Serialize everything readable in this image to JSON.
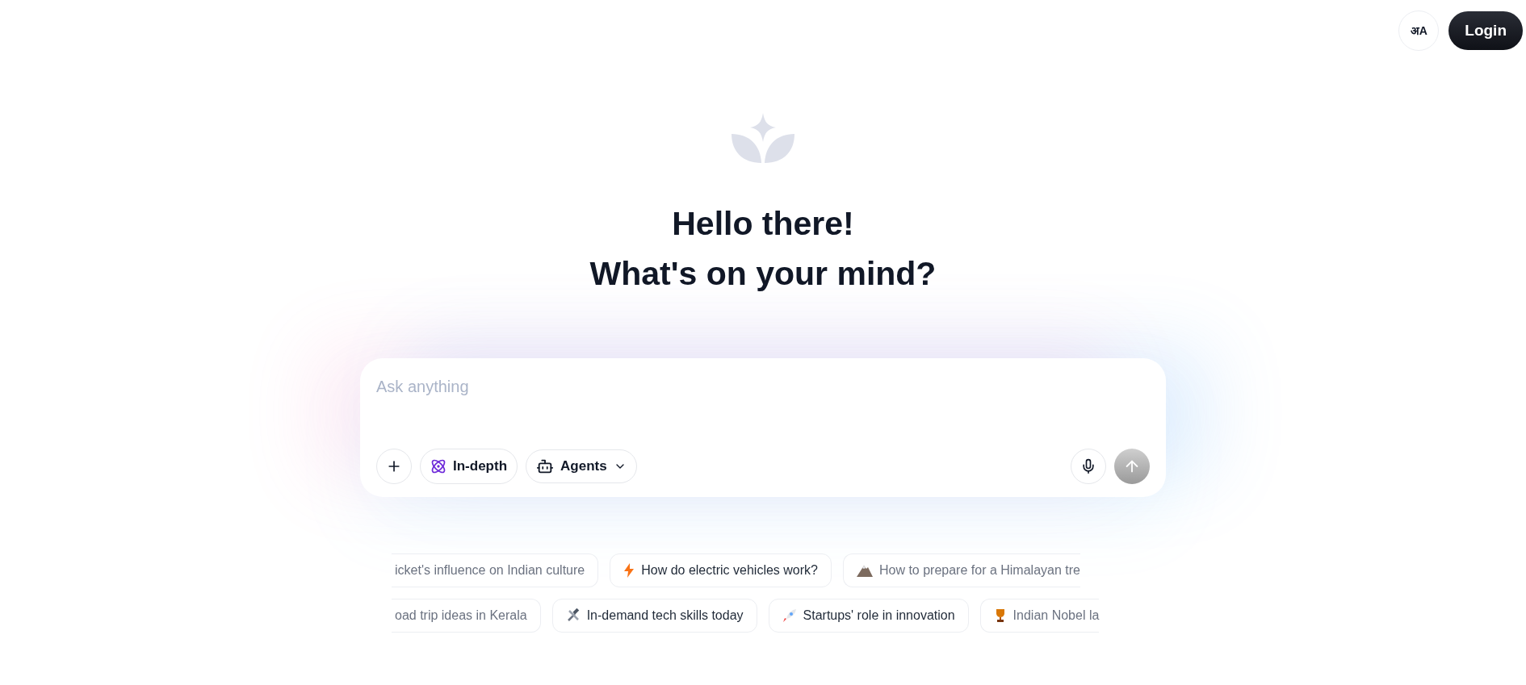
{
  "header": {
    "language_button": {
      "label": "अA"
    },
    "login_button": {
      "label": "Login"
    }
  },
  "greeting": {
    "line_1": "Hello there!",
    "line_2": "What's on your mind?"
  },
  "composer": {
    "placeholder": "Ask anything",
    "tools": [
      {
        "kind": "add"
      },
      {
        "kind": "mode",
        "label": "In-depth"
      },
      {
        "kind": "menu",
        "label": "Agents"
      }
    ],
    "actions": [
      {
        "kind": "mic"
      },
      {
        "kind": "send",
        "disabled": true
      }
    ]
  },
  "suggestions": [
    [
      {
        "label": "icket's influence on Indian culture"
      },
      {
        "kind": "bolt",
        "label": "How do electric vehicles work?"
      },
      {
        "kind": "mountain",
        "label": "How to prepare for a Himalayan tre"
      }
    ],
    [
      {
        "label": "oad trip ideas in Kerala"
      },
      {
        "kind": "tools",
        "label": "In-demand tech skills today"
      },
      {
        "kind": "rocket",
        "label": "Startups' role in innovation"
      },
      {
        "kind": "trophy",
        "label": "Indian Nobel la"
      }
    ]
  ]
}
